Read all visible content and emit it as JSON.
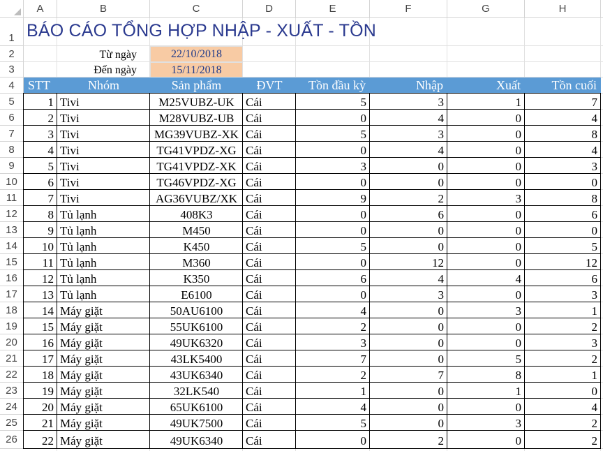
{
  "columns": [
    "A",
    "B",
    "C",
    "D",
    "E",
    "F",
    "G",
    "H"
  ],
  "title": "BÁO CÁO TỔNG HỢP NHẬP - XUẤT - TỒN",
  "from_label": "Từ ngày",
  "from_value": "22/10/2018",
  "to_label": "Đến ngày",
  "to_value": "15/11/2018",
  "headers": [
    "STT",
    "Nhóm",
    "Sản phẩm",
    "ĐVT",
    "Tồn đầu kỳ",
    "Nhập",
    "Xuất",
    "Tồn cuối"
  ],
  "row_numbers": [
    "1",
    "2",
    "3",
    "4",
    "5",
    "6",
    "7",
    "8",
    "9",
    "10",
    "11",
    "12",
    "13",
    "14",
    "15",
    "16",
    "17",
    "18",
    "19",
    "20",
    "21",
    "22",
    "23",
    "24",
    "25",
    "26"
  ],
  "rows": [
    [
      "1",
      "Tivi",
      "M25VUBZ-UK",
      "Cái",
      "5",
      "3",
      "1",
      "7"
    ],
    [
      "2",
      "Tivi",
      "M28VUBZ-UB",
      "Cái",
      "0",
      "4",
      "0",
      "4"
    ],
    [
      "3",
      "Tivi",
      "MG39VUBZ-XK",
      "Cái",
      "5",
      "3",
      "0",
      "8"
    ],
    [
      "4",
      "Tivi",
      "TG41VPDZ-XG",
      "Cái",
      "0",
      "4",
      "0",
      "4"
    ],
    [
      "5",
      "Tivi",
      "TG41VPDZ-XK",
      "Cái",
      "3",
      "0",
      "0",
      "3"
    ],
    [
      "6",
      "Tivi",
      "TG46VPDZ-XG",
      "Cái",
      "0",
      "0",
      "0",
      "0"
    ],
    [
      "7",
      "Tivi",
      "AG36VUBZ/XK",
      "Cái",
      "9",
      "2",
      "3",
      "8"
    ],
    [
      "8",
      "Tủ lạnh",
      "408K3",
      "Cái",
      "0",
      "6",
      "0",
      "6"
    ],
    [
      "9",
      "Tủ lạnh",
      "M450",
      "Cái",
      "0",
      "0",
      "0",
      "0"
    ],
    [
      "10",
      "Tủ lạnh",
      "K450",
      "Cái",
      "5",
      "0",
      "0",
      "5"
    ],
    [
      "11",
      "Tủ lạnh",
      "M360",
      "Cái",
      "0",
      "12",
      "0",
      "12"
    ],
    [
      "12",
      "Tủ lạnh",
      "K350",
      "Cái",
      "6",
      "4",
      "4",
      "6"
    ],
    [
      "13",
      "Tủ lạnh",
      "E6100",
      "Cái",
      "0",
      "3",
      "0",
      "3"
    ],
    [
      "14",
      "Máy giặt",
      "50AU6100",
      "Cái",
      "4",
      "0",
      "3",
      "1"
    ],
    [
      "15",
      "Máy giặt",
      "55UK6100",
      "Cái",
      "2",
      "0",
      "0",
      "2"
    ],
    [
      "16",
      "Máy giặt",
      "49UK6320",
      "Cái",
      "3",
      "0",
      "0",
      "3"
    ],
    [
      "17",
      "Máy giặt",
      "43LK5400",
      "Cái",
      "7",
      "0",
      "5",
      "2"
    ],
    [
      "18",
      "Máy giặt",
      "43UK6340",
      "Cái",
      "2",
      "7",
      "8",
      "1"
    ],
    [
      "19",
      "Máy giặt",
      "32LK540",
      "Cái",
      "1",
      "0",
      "1",
      "0"
    ],
    [
      "20",
      "Máy giặt",
      "65UK6100",
      "Cái",
      "4",
      "0",
      "0",
      "4"
    ],
    [
      "21",
      "Máy giặt",
      "49UK7500",
      "Cái",
      "5",
      "0",
      "3",
      "2"
    ],
    [
      "22",
      "Máy giặt",
      "49UK6340",
      "Cái",
      "0",
      "2",
      "0",
      "2"
    ]
  ]
}
